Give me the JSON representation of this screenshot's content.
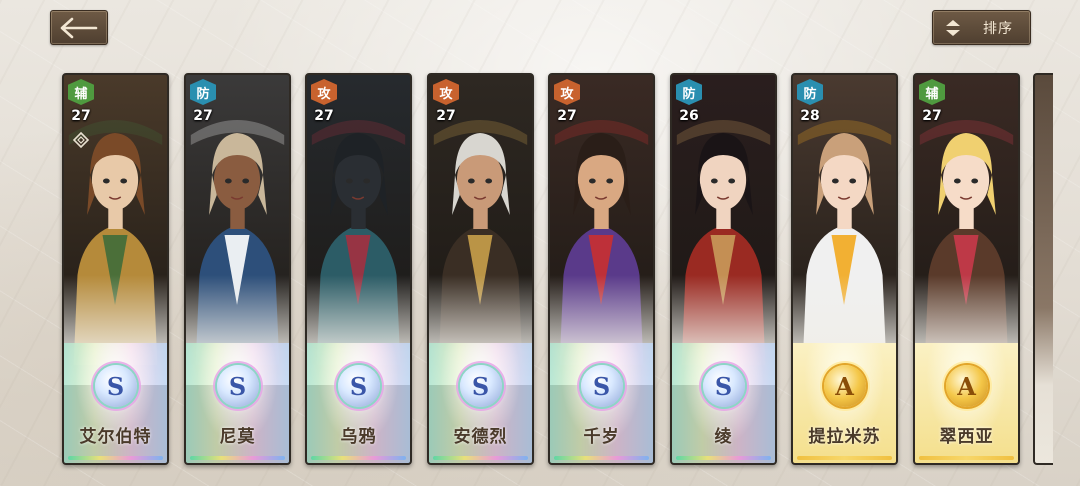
{
  "header": {
    "back_icon": "arrow-left-icon",
    "sort_label": "排序",
    "sort_icon": "sort-arrows-icon"
  },
  "colors": {
    "support": "#4f9a3f",
    "defense": "#2a8fb0",
    "attack": "#c8622e"
  },
  "cards": [
    {
      "role": "辅",
      "role_type": "support",
      "level": "27",
      "name": "艾尔伯特",
      "rank": "S",
      "locked": true,
      "palette": {
        "bg": "#4a3a2a",
        "hair": "#7a4a28",
        "skin": "#e8c9a8",
        "coat": "#b58a3a",
        "accent": "#3f6b3a"
      }
    },
    {
      "role": "防",
      "role_type": "defense",
      "level": "27",
      "name": "尼莫",
      "rank": "S",
      "locked": false,
      "palette": {
        "bg": "#3b3a3a",
        "hair": "#c9b79a",
        "skin": "#8a5c40",
        "coat": "#2d4f7a",
        "accent": "#ffffff"
      }
    },
    {
      "role": "攻",
      "role_type": "attack",
      "level": "27",
      "name": "乌鸦",
      "rank": "S",
      "locked": false,
      "palette": {
        "bg": "#262a2e",
        "hair": "#1e2226",
        "skin": "#2a2e33",
        "coat": "#2c5c66",
        "accent": "#a33040"
      }
    },
    {
      "role": "攻",
      "role_type": "attack",
      "level": "27",
      "name": "安德烈",
      "rank": "S",
      "locked": false,
      "palette": {
        "bg": "#2e2822",
        "hair": "#d8d6d0",
        "skin": "#c99a78",
        "coat": "#3a2e24",
        "accent": "#c9a04a"
      }
    },
    {
      "role": "攻",
      "role_type": "attack",
      "level": "27",
      "name": "千岁",
      "rank": "S",
      "locked": false,
      "palette": {
        "bg": "#3a2a24",
        "hair": "#2a1e18",
        "skin": "#d9a882",
        "coat": "#5a3a8a",
        "accent": "#c93030"
      }
    },
    {
      "role": "防",
      "role_type": "defense",
      "level": "26",
      "name": "绫",
      "rank": "S",
      "locked": false,
      "palette": {
        "bg": "#2a1e1e",
        "hair": "#1a1416",
        "skin": "#f0d4c0",
        "coat": "#9a2a22",
        "accent": "#c99a5a"
      }
    },
    {
      "role": "防",
      "role_type": "defense",
      "level": "28",
      "name": "提拉米苏",
      "rank": "A",
      "locked": false,
      "palette": {
        "bg": "#4a3a30",
        "hair": "#c9a07a",
        "skin": "#f4d8c4",
        "coat": "#f0f0f0",
        "accent": "#f2a81e"
      }
    },
    {
      "role": "辅",
      "role_type": "support",
      "level": "27",
      "name": "翠西亚",
      "rank": "A",
      "locked": false,
      "palette": {
        "bg": "#3a2a24",
        "hair": "#f0d070",
        "skin": "#f6dcc8",
        "coat": "#5a3a2a",
        "accent": "#c93a4a"
      }
    }
  ]
}
